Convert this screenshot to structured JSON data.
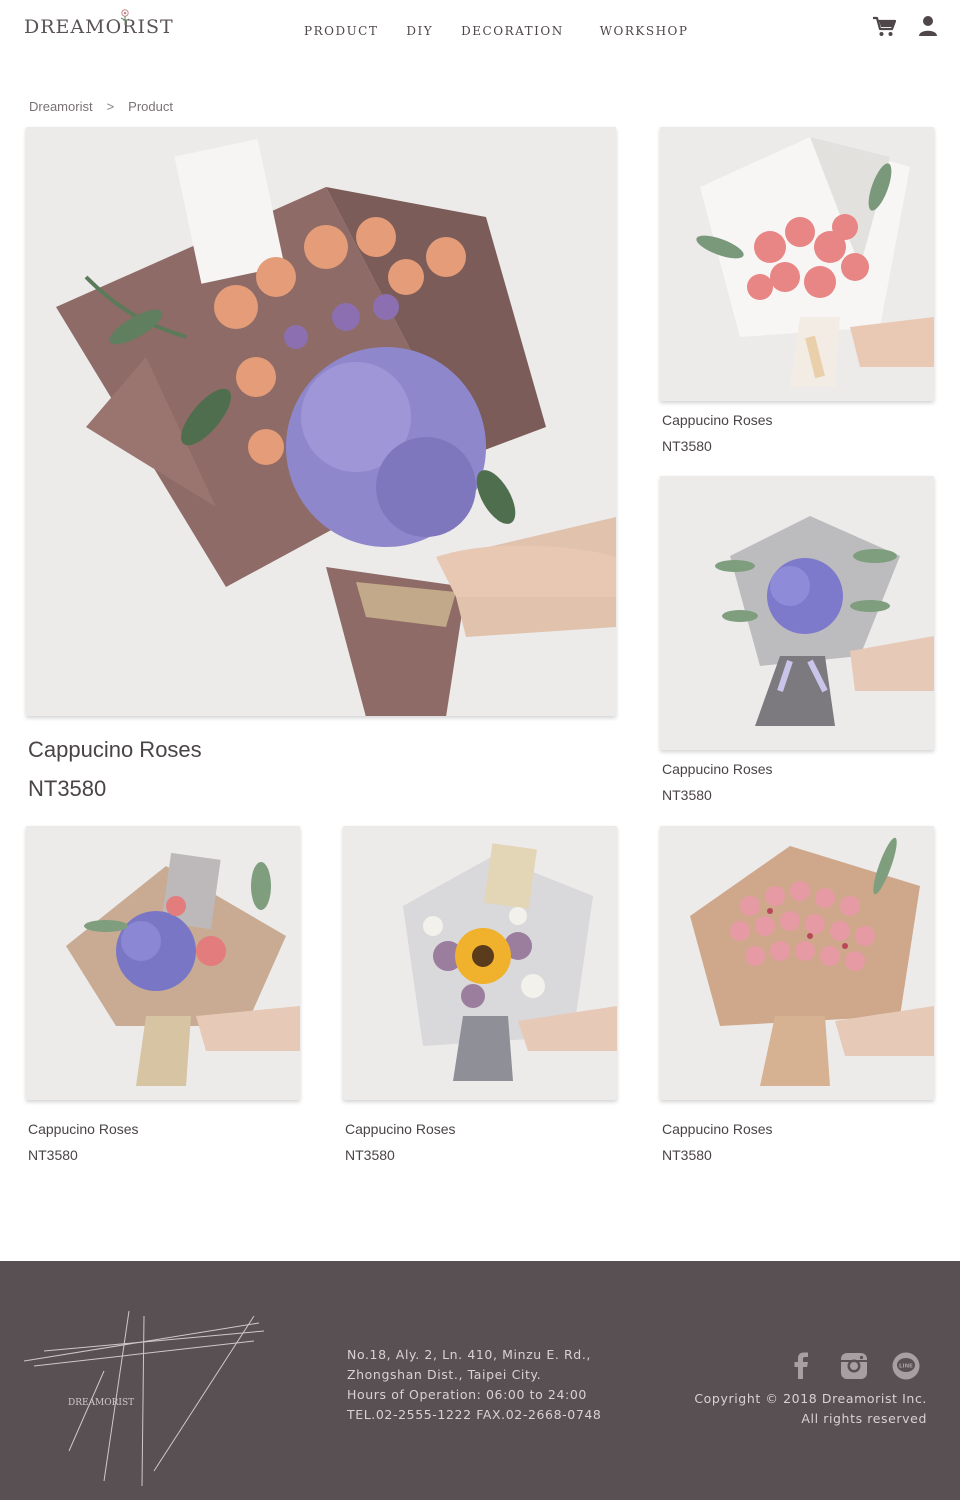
{
  "brand": {
    "logo_text": "DREAMORIST"
  },
  "nav": {
    "items": [
      {
        "label": "PRODUCT"
      },
      {
        "label": "DIY"
      },
      {
        "label": "DECORATION"
      },
      {
        "label": "WORKSHOP"
      }
    ]
  },
  "header_icons": {
    "cart": "cart-icon",
    "user": "user-icon"
  },
  "breadcrumb": {
    "home": "Dreamorist",
    "separator": ">",
    "current": "Product"
  },
  "products": {
    "featured": {
      "name": "Cappucino Roses",
      "price": "NT3580",
      "image": "bouquet-hydrangea-cappuccino-roses"
    },
    "side_1": {
      "name": "Cappucino Roses",
      "price": "NT3580",
      "image": "bouquet-pink-roses"
    },
    "side_2": {
      "name": "Cappucino Roses",
      "price": "NT3580",
      "image": "bouquet-blue-hydrangea"
    },
    "bottom_1": {
      "name": "Cappucino Roses",
      "price": "NT3580",
      "image": "bouquet-hydrangea-roses"
    },
    "bottom_2": {
      "name": "Cappucino Roses",
      "price": "NT3580",
      "image": "bouquet-sunflower"
    },
    "bottom_3": {
      "name": "Cappucino Roses",
      "price": "NT3580",
      "image": "bouquet-spray-roses"
    }
  },
  "footer": {
    "logo_text": "DREAMORIST",
    "address_line_1": "No.18, Aly. 2, Ln. 410, Minzu E. Rd.,",
    "address_line_2": "Zhongshan Dist., Taipei City.",
    "hours": "Hours of Operation: 06:00 to 24:00",
    "phone": "TEL.02-2555-1222 FAX.02-2668-0748",
    "copyright": "Copyright © 2018 Dreamorist Inc.",
    "rights": "All rights reserved",
    "social": [
      "facebook-icon",
      "instagram-icon",
      "line-icon"
    ]
  },
  "colors": {
    "footer_bg": "#585053",
    "text": "#4a4446",
    "footer_text": "#d9d2d4"
  }
}
